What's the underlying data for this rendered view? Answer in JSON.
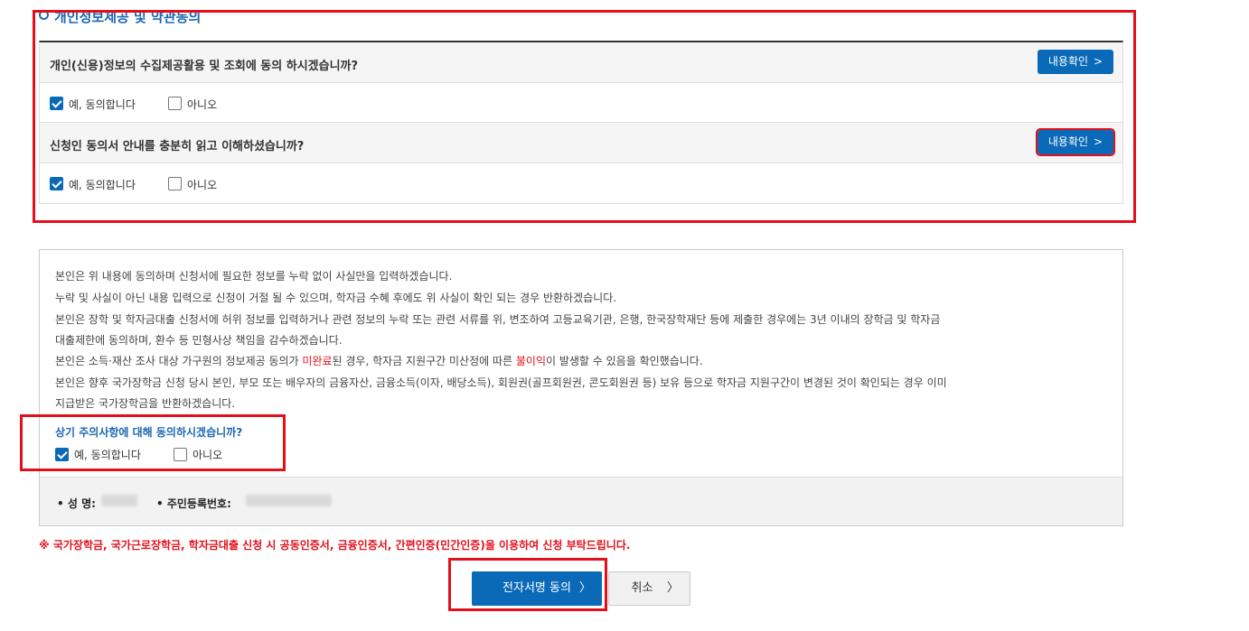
{
  "section": {
    "title": "개인정보제공 및 약관동의"
  },
  "agreements": [
    {
      "question": "개인(신용)정보의 수집제공활용 및 조회에 동의 하시겠습니까?",
      "view_button": "내용확인",
      "yes_label": "예, 동의합니다",
      "no_label": "아니오",
      "yes_checked": true,
      "no_checked": false
    },
    {
      "question": "신청인 동의서 안내를 충분히 읽고 이해하셨습니까?",
      "view_button": "내용확인",
      "yes_label": "예, 동의합니다",
      "no_label": "아니오",
      "yes_checked": true,
      "no_checked": false
    }
  ],
  "notice": {
    "lines": [
      "본인은 위 내용에 동의하며 신청서에 필요한 정보를 누락 없이 사실만을 입력하겠습니다.",
      "누락 및 사실이 아닌 내용 입력으로 신청이 거절 될 수 있으며, 학자금 수혜 후에도 위 사실이 확인 되는 경우 반환하겠습니다.",
      "본인은 장학 및 학자금대출 신청서에 허위 정보를 입력하거나 관련 정보의 누락 또는 관련 서류를 위, 변조하여 고등교육기관, 은행, 한국장학재단 등에 제출한 경우에는 3년 이내의 장학금 및 학자금",
      "대출제한에 동의하며, 환수 등 민형사상 책임을 감수하겠습니다."
    ],
    "line5_before": "본인은 소득·재산 조사 대상 가구원의 정보제공 동의가 ",
    "line5_red1": "미완료",
    "line5_mid": "된 경우, 학자금 지원구간 미산정에 따른 ",
    "line5_red2": "불이익",
    "line5_after": "이 발생할 수 있음을 확인했습니다.",
    "lines_tail": [
      "본인은 향후 국가장학금 신청 당시 본인, 부모 또는 배우자의 금융자산, 금융소득(이자, 배당소득), 회원권(골프회원권, 콘도회원권 등) 보유 등으로 학자금 지원구간이 변경된 것이 확인되는 경우 이미",
      "지급받은 국가장학금을 반환하겠습니다."
    ],
    "confirm_question": "상기 주의사항에 대해 동의하시겠습니까?",
    "yes_label": "예, 동의합니다",
    "no_label": "아니오",
    "yes_checked": true,
    "no_checked": false
  },
  "applicant": {
    "name_label": "• 성 명:",
    "rrn_label": "• 주민등록번호:"
  },
  "warning": "※ 국가장학금, 국가근로장학금, 학자금대출 신청 시 공동인증서, 금융인증서, 간편인증(민간인증)을 이용하여 신청 부탁드립니다.",
  "buttons": {
    "sign": "전자서명 동의",
    "cancel": "취소",
    "chevron": "〉"
  },
  "colors": {
    "primary": "#0a6ab8",
    "highlight": "#e3101b"
  }
}
